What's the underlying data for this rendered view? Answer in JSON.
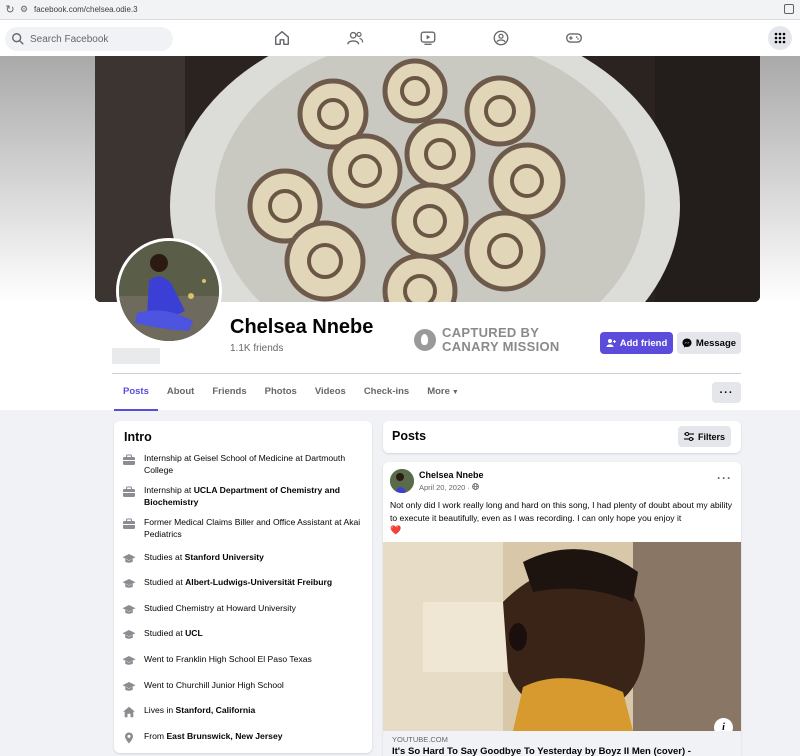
{
  "browser": {
    "url": "facebook.com/chelsea.odie.3"
  },
  "topbar": {
    "search_placeholder": "Search Facebook",
    "nav_icons": [
      "home-icon",
      "friends-icon",
      "watch-icon",
      "groups-icon",
      "gaming-icon"
    ],
    "menu_icon": "grid-menu-icon"
  },
  "profile": {
    "name": "Chelsea Nnebe",
    "friends_count": "1.1K friends",
    "add_friend_label": "Add friend",
    "message_label": "Message",
    "watermark_line1": "CAPTURED BY",
    "watermark_line2": "CANARY MISSION"
  },
  "tabs": [
    {
      "label": "Posts",
      "active": true
    },
    {
      "label": "About"
    },
    {
      "label": "Friends"
    },
    {
      "label": "Photos"
    },
    {
      "label": "Videos"
    },
    {
      "label": "Check-ins"
    },
    {
      "label": "More"
    }
  ],
  "intro": {
    "title": "Intro",
    "items": [
      {
        "icon": "work-icon",
        "prefix": "Internship at Geisel School of Medicine at Dartmouth College",
        "bold": ""
      },
      {
        "icon": "work-icon",
        "prefix": "Internship at ",
        "bold": "UCLA Department of Chemistry and Biochemistry"
      },
      {
        "icon": "work-icon",
        "prefix": "Former Medical Claims Biller and Office Assistant at Akai Pediatrics",
        "bold": ""
      },
      {
        "icon": "education-icon",
        "prefix": "Studies at ",
        "bold": "Stanford University"
      },
      {
        "icon": "education-icon",
        "prefix": "Studied at ",
        "bold": "Albert-Ludwigs-Universität Freiburg"
      },
      {
        "icon": "education-icon",
        "prefix": "Studied Chemistry at Howard University",
        "bold": ""
      },
      {
        "icon": "education-icon",
        "prefix": "Studied at ",
        "bold": "UCL"
      },
      {
        "icon": "education-icon",
        "prefix": "Went to Franklin High School El Paso Texas",
        "bold": ""
      },
      {
        "icon": "education-icon",
        "prefix": "Went to Churchill Junior High School",
        "bold": ""
      },
      {
        "icon": "home-icon",
        "prefix": "Lives in ",
        "bold": "Stanford, California"
      },
      {
        "icon": "location-icon",
        "prefix": "From ",
        "bold": "East Brunswick, New Jersey"
      }
    ]
  },
  "posts": {
    "title": "Posts",
    "filters_label": "Filters",
    "post": {
      "author": "Chelsea Nnebe",
      "date": "April 20, 2020 · ",
      "privacy_icon": "globe-icon",
      "text": "Not only did I work really long and hard on this song, I had plenty of doubt about my ability to execute it beautifully, even as I was recording. I can only hope you enjoy it",
      "emoji": "❤️",
      "link_source": "YOUTUBE.COM",
      "link_title": "It's So Hard To Say Goodbye To Yesterday by Boyz II Men (cover) -"
    }
  },
  "colors": {
    "accent": "#5b4cdb",
    "background": "#f0f2f5",
    "heart": "#e41e3f"
  }
}
